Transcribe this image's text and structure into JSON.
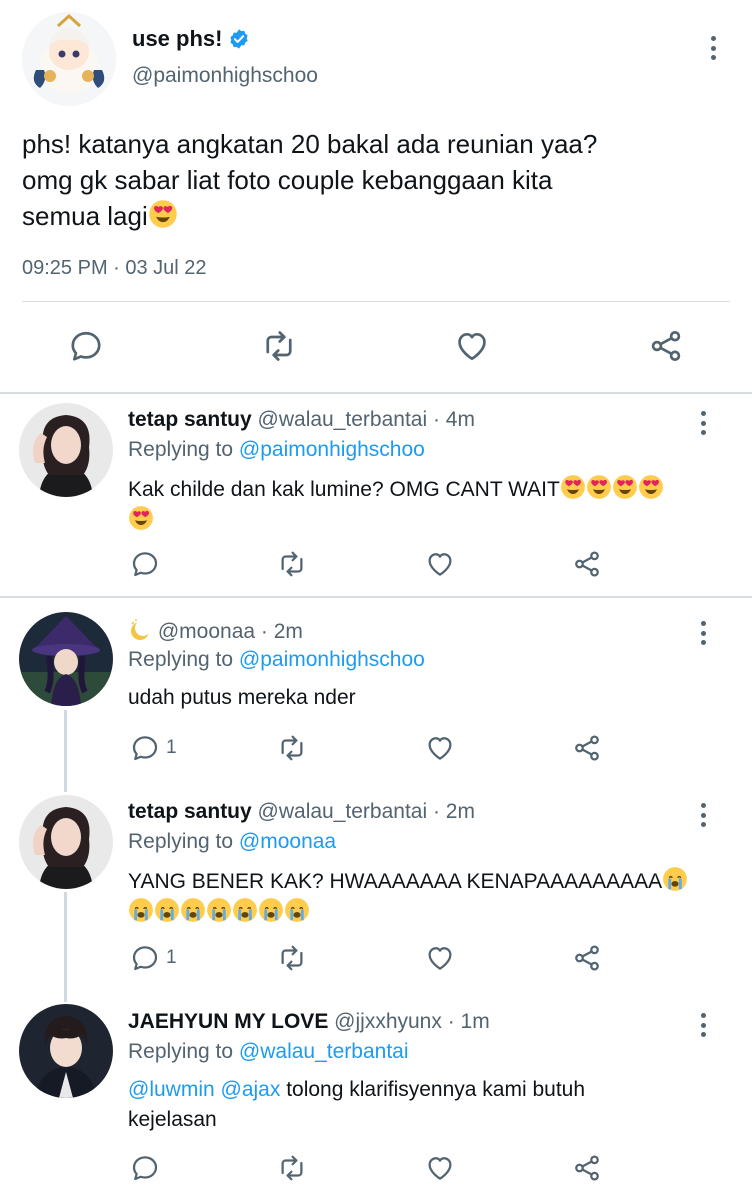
{
  "main": {
    "name": "use phs!",
    "handle": "@paimonhighschoo",
    "text_line1": "phs! katanya angkatan 20 bakal ada reunian yaa?",
    "text_line2": "omg gk sabar liat foto couple kebanggaan kita",
    "text_line3": "semua lagi",
    "timestamp": "09:25 PM · 03 Jul 22",
    "icons": [
      "reply-icon",
      "retweet-icon",
      "like-icon",
      "share-icon"
    ]
  },
  "replies": [
    {
      "name": "tetap santuy",
      "handle": "@walau_terbantai",
      "time": "· 4m",
      "replying_prefix": "Replying to",
      "replying_to": "@paimonhighschoo",
      "text": "Kak childe dan kak lumine? OMG CANT WAIT",
      "reply_count": ""
    },
    {
      "name": "",
      "handle": "@moonaa",
      "time": "· 2m",
      "replying_prefix": "Replying to",
      "replying_to": "@paimonhighschoo",
      "text": "udah putus mereka nder",
      "reply_count": "1"
    },
    {
      "name": "tetap santuy",
      "handle": "@walau_terbantai",
      "time": "· 2m",
      "replying_prefix": "Replying to",
      "replying_to": "@moonaa",
      "text": "YANG BENER KAK? HWAAAAAAA KENAPAAAAAAAAA",
      "reply_count": "1"
    },
    {
      "name": "JAEHYUN MY LOVE",
      "handle": "@jjxxhyunx",
      "time": "· 1m",
      "replying_prefix": "Replying to",
      "replying_to": "@walau_terbantai",
      "mention1": "@luwmin",
      "mention2": "@ajax",
      "text_rest": " tolong klarifisyennya kami butuh",
      "text_line2": "kejelasan",
      "reply_count": ""
    }
  ],
  "colors": {
    "accent": "#1d9bf0",
    "text": "#0f1419",
    "secondary": "#536471",
    "divider": "#d9dde1"
  }
}
